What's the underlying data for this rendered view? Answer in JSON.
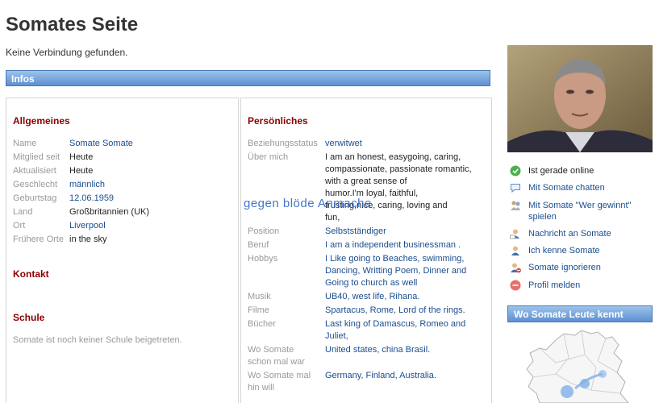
{
  "page": {
    "title": "Somates Seite",
    "connection_status": "Keine Verbindung gefunden.",
    "infos_label": "Infos",
    "watermark": "gegen blöde Anmache"
  },
  "allgemeines": {
    "heading": "Allgemeines",
    "rows": [
      {
        "label": "Name",
        "value": "Somate Somate",
        "link": true
      },
      {
        "label": "Mitglied seit",
        "value": "Heute",
        "link": false
      },
      {
        "label": "Aktualisiert",
        "value": "Heute",
        "link": false
      },
      {
        "label": "Geschlecht",
        "value": "männlich",
        "link": true
      },
      {
        "label": "Geburtstag",
        "value": "12.06.1959",
        "link": true
      },
      {
        "label": "Land",
        "value": "Großbritannien (UK)",
        "link": false
      },
      {
        "label": "Ort",
        "value": "Liverpool",
        "link": true
      },
      {
        "label": "Frühere Orte",
        "value": "in the sky",
        "link": false
      }
    ]
  },
  "kontakt": {
    "heading": "Kontakt"
  },
  "schule": {
    "heading": "Schule",
    "text": "Somate ist noch keiner Schule beigetreten."
  },
  "persoenliches": {
    "heading": "Persönliches",
    "beziehungsstatus_label": "Beziehungsstatus",
    "beziehungsstatus_value": "verwitwet",
    "ueber_mich_label": "Über mich",
    "ueber_mich_lines": [
      "I am an honest, easygoing, caring,",
      "compassionate, passionate romantic,",
      "with a great sense of",
      "humor.I'm loyal, faithful,",
      "trusting,nice, caring, loving and",
      "fun,"
    ],
    "position_label": "Position",
    "position_value": "Selbstständiger",
    "beruf_label": "Beruf",
    "beruf_value": "I am a independent businessman .",
    "hobbys_label": "Hobbys",
    "hobbys_lines": [
      "I Like going to Beaches, swimming,",
      "Dancing, Writting Poem, Dinner and",
      "Going to church as well"
    ],
    "musik_label": "Musik",
    "musik_value": "UB40, west life, Rihana.",
    "filme_label": "Filme",
    "filme_value": "Spartacus, Rome, Lord of the rings.",
    "buecher_label": "Bücher",
    "buecher_lines": [
      "Last king of Damascus, Romeo and",
      "Juliet,"
    ],
    "schon_label_lines": [
      "Wo Somate",
      "schon mal war"
    ],
    "schon_value": "United states, china Brasil.",
    "hin_label_lines": [
      "Wo Somate mal",
      "hin will"
    ],
    "hin_value": "Germany, Finland, Australia."
  },
  "sidebar": {
    "actions": [
      {
        "icon": "online-check-icon",
        "label": "Ist gerade online",
        "link": false
      },
      {
        "icon": "chat-bubble-icon",
        "label": "Mit Somate chatten",
        "link": true
      },
      {
        "icon": "game-icon",
        "label": "Mit Somate \"Wer gewinnt\" spielen",
        "link": true
      },
      {
        "icon": "message-icon",
        "label": "Nachricht an Somate",
        "link": true
      },
      {
        "icon": "user-add-icon",
        "label": "Ich kenne Somate",
        "link": true
      },
      {
        "icon": "user-block-icon",
        "label": "Somate ignorieren",
        "link": true
      },
      {
        "icon": "report-icon",
        "label": "Profil melden",
        "link": true
      }
    ],
    "friends_map_label": "Wo Somate Leute kennt"
  }
}
